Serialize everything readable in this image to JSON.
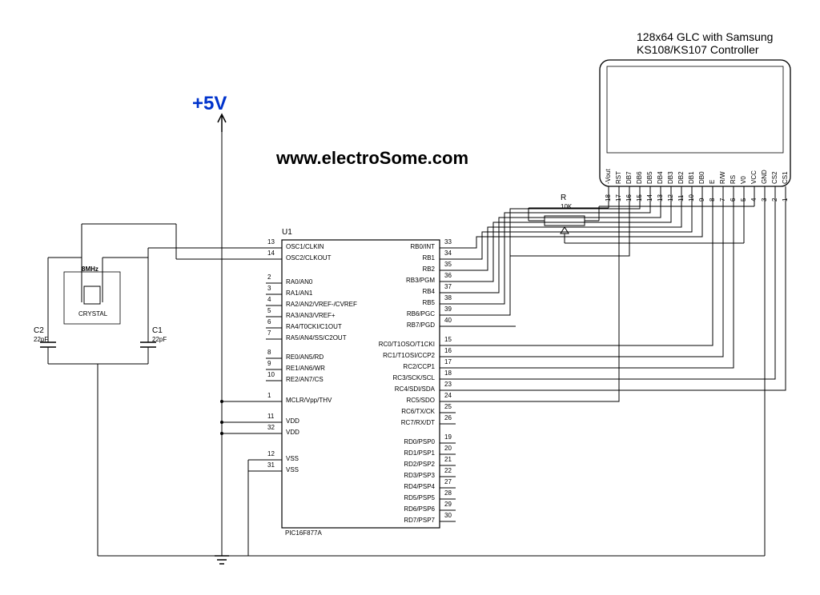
{
  "title": {
    "line1": "128x64 GLC with Samsung",
    "line2": "KS108/KS107 Controller"
  },
  "power": "+5V",
  "website": "www.electroSome.com",
  "crystal": {
    "freq": "8MHz",
    "label": "CRYSTAL"
  },
  "caps": {
    "c1": {
      "name": "C1",
      "val": "22pF"
    },
    "c2": {
      "name": "C2",
      "val": "22pF"
    }
  },
  "resistor": {
    "name": "R",
    "val": "10K"
  },
  "mcu": {
    "ref": "U1",
    "part": "PIC16F877A",
    "left_pins": [
      {
        "num": "13",
        "name": "OSC1/CLKIN"
      },
      {
        "num": "14",
        "name": "OSC2/CLKOUT"
      },
      {
        "num": "2",
        "name": "RA0/AN0"
      },
      {
        "num": "3",
        "name": "RA1/AN1"
      },
      {
        "num": "4",
        "name": "RA2/AN2/VREF-/CVREF"
      },
      {
        "num": "5",
        "name": "RA3/AN3/VREF+"
      },
      {
        "num": "6",
        "name": "RA4/T0CKI/C1OUT"
      },
      {
        "num": "7",
        "name": "RA5/AN4/SS/C2OUT"
      },
      {
        "num": "8",
        "name": "RE0/AN5/RD"
      },
      {
        "num": "9",
        "name": "RE1/AN6/WR"
      },
      {
        "num": "10",
        "name": "RE2/AN7/CS"
      },
      {
        "num": "1",
        "name": "MCLR/Vpp/THV"
      },
      {
        "num": "11",
        "name": "VDD"
      },
      {
        "num": "32",
        "name": "VDD"
      },
      {
        "num": "12",
        "name": "VSS"
      },
      {
        "num": "31",
        "name": "VSS"
      }
    ],
    "right_pins": [
      {
        "num": "33",
        "name": "RB0/INT"
      },
      {
        "num": "34",
        "name": "RB1"
      },
      {
        "num": "35",
        "name": "RB2"
      },
      {
        "num": "36",
        "name": "RB3/PGM"
      },
      {
        "num": "37",
        "name": "RB4"
      },
      {
        "num": "38",
        "name": "RB5"
      },
      {
        "num": "39",
        "name": "RB6/PGC"
      },
      {
        "num": "40",
        "name": "RB7/PGD"
      },
      {
        "num": "15",
        "name": "RC0/T1OSO/T1CKI"
      },
      {
        "num": "16",
        "name": "RC1/T1OSI/CCP2"
      },
      {
        "num": "17",
        "name": "RC2/CCP1"
      },
      {
        "num": "18",
        "name": "RC3/SCK/SCL"
      },
      {
        "num": "23",
        "name": "RC4/SDI/SDA"
      },
      {
        "num": "24",
        "name": "RC5/SDO"
      },
      {
        "num": "25",
        "name": "RC6/TX/CK"
      },
      {
        "num": "26",
        "name": "RC7/RX/DT"
      },
      {
        "num": "19",
        "name": "RD0/PSP0"
      },
      {
        "num": "20",
        "name": "RD1/PSP1"
      },
      {
        "num": "21",
        "name": "RD2/PSP2"
      },
      {
        "num": "22",
        "name": "RD3/PSP3"
      },
      {
        "num": "27",
        "name": "RD4/PSP4"
      },
      {
        "num": "28",
        "name": "RD5/PSP5"
      },
      {
        "num": "29",
        "name": "RD6/PSP6"
      },
      {
        "num": "30",
        "name": "RD7/PSP7"
      }
    ]
  },
  "lcd": {
    "pins": [
      "-Vout",
      "RST",
      "DB7",
      "DB6",
      "DB5",
      "DB4",
      "DB3",
      "DB2",
      "DB1",
      "DB0",
      "E",
      "R/W",
      "RS",
      "V0",
      "VCC",
      "GND",
      "CS2",
      "CS1"
    ],
    "nums": [
      "18",
      "17",
      "16",
      "15",
      "14",
      "13",
      "12",
      "11",
      "10",
      "9",
      "8",
      "7",
      "6",
      "5",
      "4",
      "3",
      "2",
      "1"
    ]
  }
}
